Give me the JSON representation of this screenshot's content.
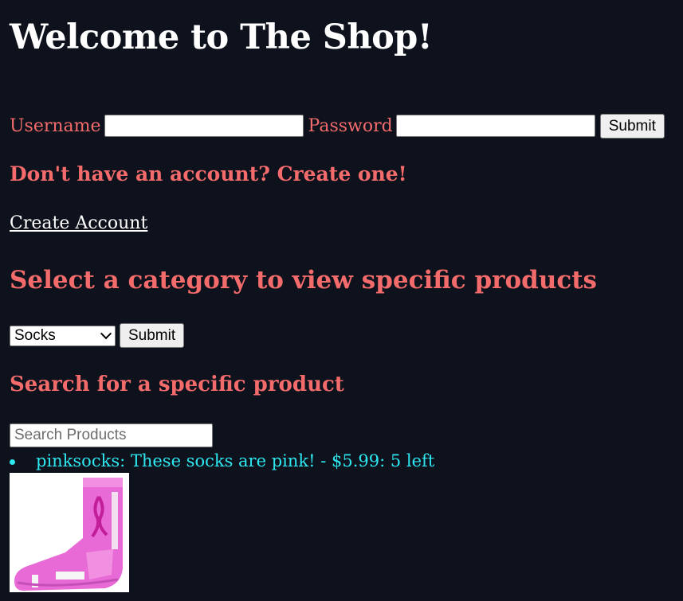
{
  "header": {
    "title": "Welcome to The Shop!"
  },
  "login": {
    "username_label": "Username",
    "username_value": "",
    "password_label": "Password",
    "password_value": "",
    "submit_label": "Submit"
  },
  "account": {
    "prompt": "Don't have an account? Create one!",
    "create_link": "Create Account"
  },
  "category": {
    "heading": "Select a category to view specific products",
    "selected": "Socks",
    "submit_label": "Submit"
  },
  "search": {
    "heading": "Search for a specific product",
    "placeholder": "Search Products",
    "value": ""
  },
  "products": [
    {
      "text": "pinksocks: These socks are pink! - $5.99: 5 left",
      "image_icon": "pink-sock-image"
    }
  ],
  "colors": {
    "background": "#0e121d",
    "heading_pink": "#f46b6b",
    "product_cyan": "#2ee8f0",
    "sock_pink": "#e86ad6"
  }
}
